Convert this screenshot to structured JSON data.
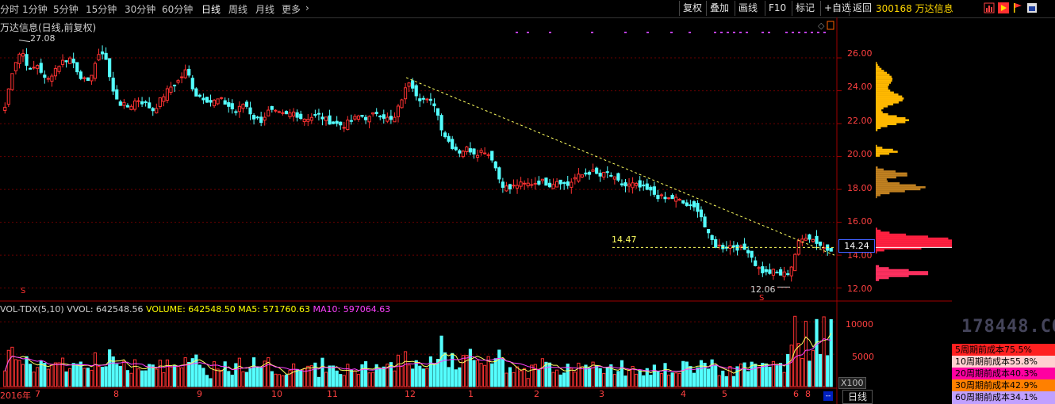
{
  "toolbar": {
    "periods": [
      "分时",
      "1分钟",
      "5分钟",
      "15分钟",
      "30分钟",
      "60分钟",
      "日线",
      "周线",
      "月线",
      "更多"
    ],
    "active_period": "日线",
    "buttons": [
      "复权",
      "叠加",
      "画线",
      "F10",
      "标记",
      "+自选",
      "返回"
    ],
    "stock_code": "300168",
    "stock_name": "万达信息"
  },
  "chart_title": "万达信息(日线,前复权)",
  "price_axis": {
    "ticks": [
      "26.00",
      "24.00",
      "22.00",
      "20.00",
      "18.00",
      "16.00",
      "14.00",
      "12.00"
    ],
    "current_price": "14.24"
  },
  "annotations": {
    "high": "27.08",
    "low": "12.06",
    "support_level": "14.47"
  },
  "volume": {
    "indicator": "VOL-TDX(5,10)",
    "vol": "VVOL: 642548.56",
    "volume": "VOLUME: 642548.50",
    "ma5": "MA5: 571760.63",
    "ma10": "MA10: 597064.63",
    "axis_ticks": [
      "10000",
      "5000"
    ],
    "unit": "X100"
  },
  "x_axis": [
    "2016年",
    "7",
    "8",
    "9",
    "10",
    "11",
    "12",
    "1",
    "2",
    "3",
    "4",
    "5",
    "6",
    "8"
  ],
  "cost_stats": [
    {
      "label": "5周期前成本75.5%",
      "color": "#ff2020",
      "text_color": "#000000"
    },
    {
      "label": "10周期前成本55.8%",
      "color": "#ffd0d0",
      "text_color": "#000000"
    },
    {
      "label": "20周期前成本40.3%",
      "color": "#ff00a0",
      "text_color": "#000000"
    },
    {
      "label": "30周期前成本42.9%",
      "color": "#ff8000",
      "text_color": "#000000"
    },
    {
      "label": "60周期前成本34.1%",
      "color": "#c0a0ff",
      "text_color": "#000000"
    }
  ],
  "bottom_tab": "日线",
  "watermark": "178448.COM",
  "chart_data": {
    "type": "candlestick",
    "title": "万达信息(日线,前复权)",
    "ylim": [
      11.5,
      27.4
    ],
    "x_ticks": [
      "2016年",
      "7",
      "8",
      "9",
      "10",
      "11",
      "12",
      "1",
      "2",
      "3",
      "4",
      "5",
      "6",
      "8"
    ],
    "close_series": [
      23,
      25.5,
      26.5,
      25.2,
      25.6,
      24.5,
      25.3,
      25.8,
      26,
      25,
      24.4,
      25.8,
      26.5,
      24,
      23.2,
      23,
      23.5,
      23.2,
      22.8,
      23.6,
      24.2,
      24.6,
      25.3,
      23.8,
      23.6,
      23.3,
      23.5,
      23.1,
      22.7,
      23.3,
      22.4,
      22.2,
      22.8,
      22.6,
      22.5,
      22.7,
      22.3,
      22.4,
      22.5,
      22.2,
      22,
      21.9,
      22.2,
      22.5,
      22.3,
      22.7,
      22.4,
      22.1,
      23.5,
      24.7,
      23.6,
      23.4,
      23.2,
      21.5,
      20.7,
      20.3,
      20.5,
      20.2,
      20.4,
      19.9,
      18.4,
      18,
      18.3,
      18.3,
      18.4,
      18.5,
      18.3,
      18.6,
      18.2,
      18.7,
      18.9,
      19.1,
      18.8,
      19,
      18.5,
      18.2,
      18.3,
      18.1,
      17.9,
      17.6,
      17.4,
      17.5,
      17.2,
      16.9,
      16.8,
      15.3,
      14.6,
      14.5,
      14.6,
      14.4,
      14.3,
      13.3,
      12.9,
      13,
      12.8,
      13,
      14.7,
      15.2,
      14.9,
      14.5,
      14.24
    ],
    "high": 27.08,
    "low": 12.06,
    "support_line": 14.47,
    "current_price": 14.24,
    "volume_ylim": [
      0,
      11500
    ],
    "volume_ticks": [
      5000,
      10000
    ]
  }
}
